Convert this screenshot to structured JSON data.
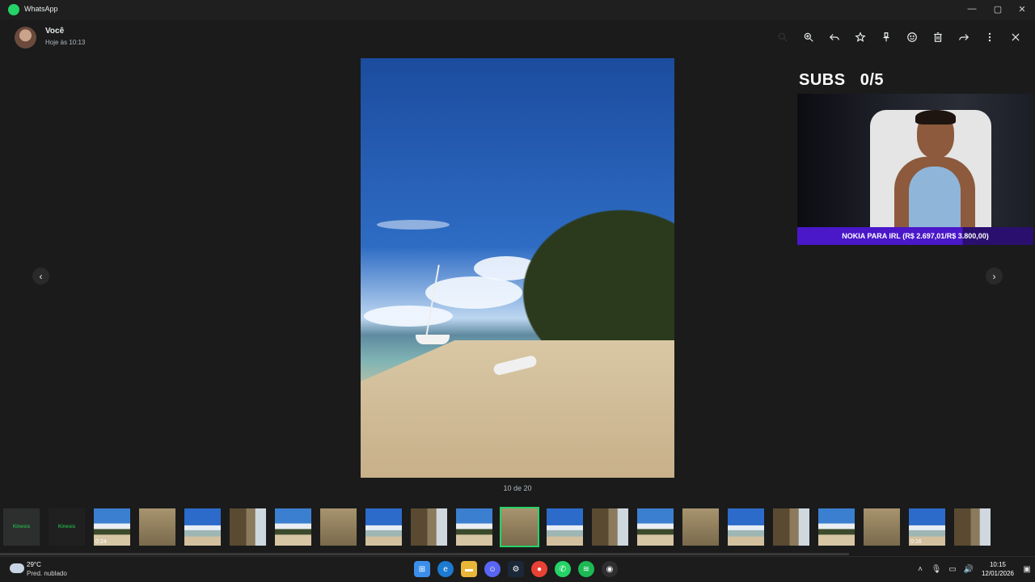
{
  "window": {
    "title": "WhatsApp"
  },
  "header": {
    "sender": "Você",
    "timestamp": "Hoje às 10:13"
  },
  "viewer": {
    "counter": "10 de 20"
  },
  "toolbar": {
    "icons": [
      "search-icon",
      "zoom-in-icon",
      "reply-icon",
      "star-icon",
      "pin-icon",
      "emoji-icon",
      "delete-icon",
      "forward-icon",
      "more-icon",
      "close-icon"
    ]
  },
  "overlay": {
    "subs_label": "SUBS   0/5",
    "banner": "NOKIA PARA IRL (R$ 2.697,01/R$ 3.800,00)",
    "goal_progress": 0.71
  },
  "thumbnails": [
    {
      "kind": "image-text",
      "text": "Kinesis"
    },
    {
      "kind": "image-text",
      "text": "Kinesis"
    },
    {
      "kind": "video",
      "duration": "0:24"
    },
    {
      "kind": "image"
    },
    {
      "kind": "image"
    },
    {
      "kind": "image"
    },
    {
      "kind": "image"
    },
    {
      "kind": "image"
    },
    {
      "kind": "image"
    },
    {
      "kind": "image"
    },
    {
      "kind": "image"
    },
    {
      "kind": "image",
      "selected": true
    },
    {
      "kind": "image"
    },
    {
      "kind": "image"
    },
    {
      "kind": "image"
    },
    {
      "kind": "image"
    },
    {
      "kind": "image"
    },
    {
      "kind": "image"
    },
    {
      "kind": "image"
    },
    {
      "kind": "image"
    },
    {
      "kind": "video",
      "duration": "0:16"
    },
    {
      "kind": "image"
    }
  ],
  "taskbar": {
    "weather": {
      "temp": "29°C",
      "desc": "Pred. nublado"
    },
    "apps": [
      "windows-start-icon",
      "edge-icon",
      "file-explorer-icon",
      "discord-icon",
      "steam-icon",
      "chrome-icon",
      "whatsapp-icon",
      "spotify-icon",
      "obs-icon"
    ],
    "clock": {
      "time": "10:15",
      "date": "12/01/2026"
    }
  },
  "colors": {
    "accent": "#25d366",
    "banner": "#4a17c9"
  }
}
